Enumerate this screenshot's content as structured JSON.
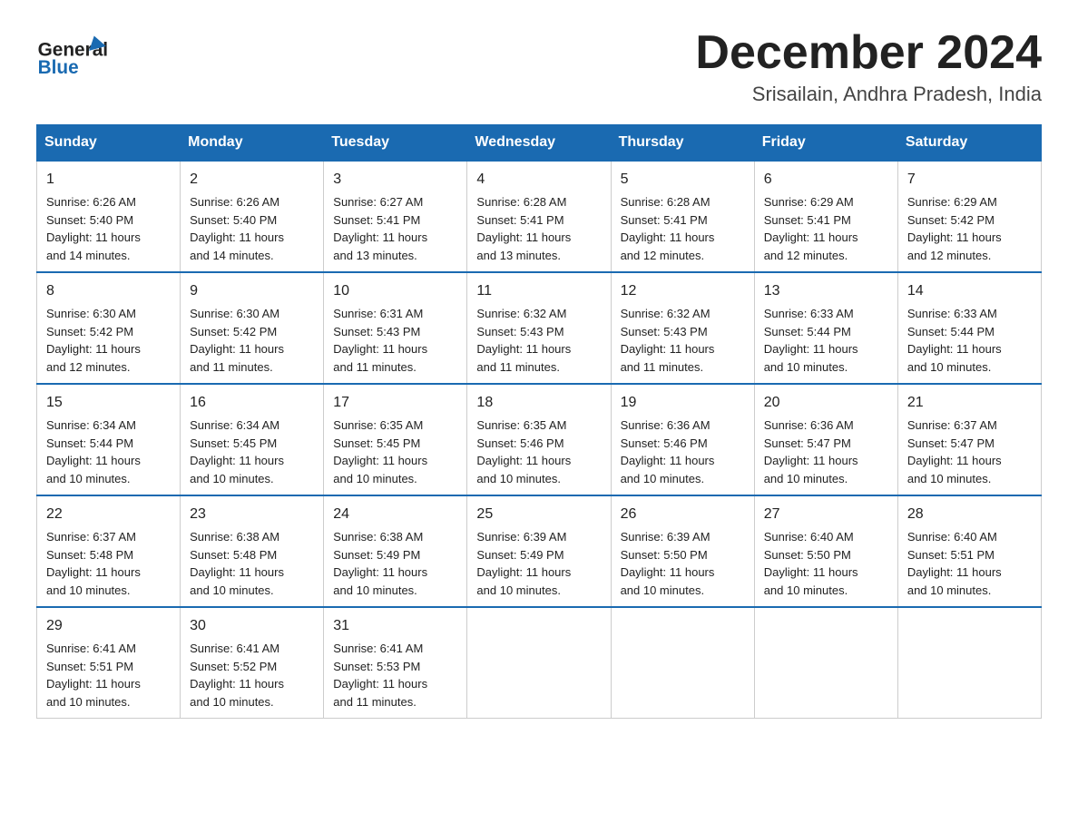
{
  "header": {
    "logo_general": "General",
    "logo_blue": "Blue",
    "month_title": "December 2024",
    "location": "Srisailain, Andhra Pradesh, India"
  },
  "days_of_week": [
    "Sunday",
    "Monday",
    "Tuesday",
    "Wednesday",
    "Thursday",
    "Friday",
    "Saturday"
  ],
  "weeks": [
    [
      {
        "day": "1",
        "sunrise": "6:26 AM",
        "sunset": "5:40 PM",
        "daylight": "11 hours and 14 minutes."
      },
      {
        "day": "2",
        "sunrise": "6:26 AM",
        "sunset": "5:40 PM",
        "daylight": "11 hours and 14 minutes."
      },
      {
        "day": "3",
        "sunrise": "6:27 AM",
        "sunset": "5:41 PM",
        "daylight": "11 hours and 13 minutes."
      },
      {
        "day": "4",
        "sunrise": "6:28 AM",
        "sunset": "5:41 PM",
        "daylight": "11 hours and 13 minutes."
      },
      {
        "day": "5",
        "sunrise": "6:28 AM",
        "sunset": "5:41 PM",
        "daylight": "11 hours and 12 minutes."
      },
      {
        "day": "6",
        "sunrise": "6:29 AM",
        "sunset": "5:41 PM",
        "daylight": "11 hours and 12 minutes."
      },
      {
        "day": "7",
        "sunrise": "6:29 AM",
        "sunset": "5:42 PM",
        "daylight": "11 hours and 12 minutes."
      }
    ],
    [
      {
        "day": "8",
        "sunrise": "6:30 AM",
        "sunset": "5:42 PM",
        "daylight": "11 hours and 12 minutes."
      },
      {
        "day": "9",
        "sunrise": "6:30 AM",
        "sunset": "5:42 PM",
        "daylight": "11 hours and 11 minutes."
      },
      {
        "day": "10",
        "sunrise": "6:31 AM",
        "sunset": "5:43 PM",
        "daylight": "11 hours and 11 minutes."
      },
      {
        "day": "11",
        "sunrise": "6:32 AM",
        "sunset": "5:43 PM",
        "daylight": "11 hours and 11 minutes."
      },
      {
        "day": "12",
        "sunrise": "6:32 AM",
        "sunset": "5:43 PM",
        "daylight": "11 hours and 11 minutes."
      },
      {
        "day": "13",
        "sunrise": "6:33 AM",
        "sunset": "5:44 PM",
        "daylight": "11 hours and 10 minutes."
      },
      {
        "day": "14",
        "sunrise": "6:33 AM",
        "sunset": "5:44 PM",
        "daylight": "11 hours and 10 minutes."
      }
    ],
    [
      {
        "day": "15",
        "sunrise": "6:34 AM",
        "sunset": "5:44 PM",
        "daylight": "11 hours and 10 minutes."
      },
      {
        "day": "16",
        "sunrise": "6:34 AM",
        "sunset": "5:45 PM",
        "daylight": "11 hours and 10 minutes."
      },
      {
        "day": "17",
        "sunrise": "6:35 AM",
        "sunset": "5:45 PM",
        "daylight": "11 hours and 10 minutes."
      },
      {
        "day": "18",
        "sunrise": "6:35 AM",
        "sunset": "5:46 PM",
        "daylight": "11 hours and 10 minutes."
      },
      {
        "day": "19",
        "sunrise": "6:36 AM",
        "sunset": "5:46 PM",
        "daylight": "11 hours and 10 minutes."
      },
      {
        "day": "20",
        "sunrise": "6:36 AM",
        "sunset": "5:47 PM",
        "daylight": "11 hours and 10 minutes."
      },
      {
        "day": "21",
        "sunrise": "6:37 AM",
        "sunset": "5:47 PM",
        "daylight": "11 hours and 10 minutes."
      }
    ],
    [
      {
        "day": "22",
        "sunrise": "6:37 AM",
        "sunset": "5:48 PM",
        "daylight": "11 hours and 10 minutes."
      },
      {
        "day": "23",
        "sunrise": "6:38 AM",
        "sunset": "5:48 PM",
        "daylight": "11 hours and 10 minutes."
      },
      {
        "day": "24",
        "sunrise": "6:38 AM",
        "sunset": "5:49 PM",
        "daylight": "11 hours and 10 minutes."
      },
      {
        "day": "25",
        "sunrise": "6:39 AM",
        "sunset": "5:49 PM",
        "daylight": "11 hours and 10 minutes."
      },
      {
        "day": "26",
        "sunrise": "6:39 AM",
        "sunset": "5:50 PM",
        "daylight": "11 hours and 10 minutes."
      },
      {
        "day": "27",
        "sunrise": "6:40 AM",
        "sunset": "5:50 PM",
        "daylight": "11 hours and 10 minutes."
      },
      {
        "day": "28",
        "sunrise": "6:40 AM",
        "sunset": "5:51 PM",
        "daylight": "11 hours and 10 minutes."
      }
    ],
    [
      {
        "day": "29",
        "sunrise": "6:41 AM",
        "sunset": "5:51 PM",
        "daylight": "11 hours and 10 minutes."
      },
      {
        "day": "30",
        "sunrise": "6:41 AM",
        "sunset": "5:52 PM",
        "daylight": "11 hours and 10 minutes."
      },
      {
        "day": "31",
        "sunrise": "6:41 AM",
        "sunset": "5:53 PM",
        "daylight": "11 hours and 11 minutes."
      },
      null,
      null,
      null,
      null
    ]
  ],
  "labels": {
    "sunrise_prefix": "Sunrise: ",
    "sunset_prefix": "Sunset: ",
    "daylight_prefix": "Daylight: "
  }
}
